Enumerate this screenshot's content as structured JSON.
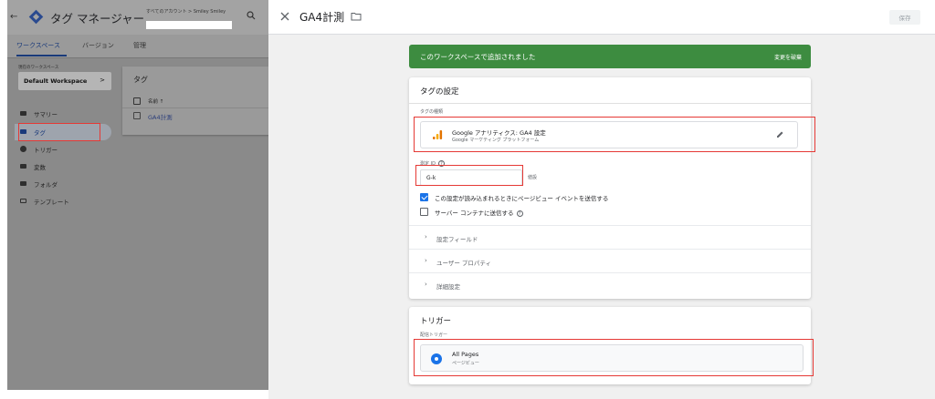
{
  "left": {
    "app_title": "タグ マネージャー",
    "account_crumb": "すべてのアカウント > Smiley Smiley",
    "nav_tabs": [
      "ワークスペース",
      "バージョン",
      "管理"
    ],
    "workspace_label": "現在のワークスペース",
    "workspace_name": "Default Workspace",
    "workspace_arrow": ">",
    "sidebar": [
      {
        "label": "サマリー",
        "icon": "briefcase-icon"
      },
      {
        "label": "タグ",
        "icon": "tag-icon"
      },
      {
        "label": "トリガー",
        "icon": "trigger-icon"
      },
      {
        "label": "変数",
        "icon": "variable-icon"
      },
      {
        "label": "フォルダ",
        "icon": "folder-icon"
      },
      {
        "label": "テンプレート",
        "icon": "template-icon"
      }
    ],
    "tags_card": {
      "title": "タグ",
      "col_name": "名前 ↑",
      "col_type": "タ",
      "rows": [
        {
          "name": "GA4計測",
          "type": "G\n設"
        }
      ]
    }
  },
  "right": {
    "close_icon": "close-icon",
    "title": "GA4計測",
    "folder_icon": "folder-outline-icon",
    "save_label": "保存",
    "banner": {
      "text": "このワークスペースで追加されました",
      "discard": "変更を破棄",
      "color": "#3d8c40"
    },
    "config": {
      "title": "タグの設定",
      "type_label": "タグの種類",
      "type_name": "Google アナリティクス: GA4 設定",
      "type_sub": "Google マーケティング プラットフォーム",
      "measurement_label": "測定 ID",
      "measurement_value": "G-k",
      "lookup_label": "値設",
      "checks": [
        {
          "label": "この設定が読み込まれるときにページビュー イベントを送信する",
          "checked": true
        },
        {
          "label": "サーバー コンテナに送信する",
          "checked": false
        }
      ],
      "collapsibles": [
        "設定フィールド",
        "ユーザー プロパティ",
        "詳細設定"
      ]
    },
    "triggers": {
      "title": "トリガー",
      "label": "配信トリガー",
      "items": [
        {
          "name": "All Pages",
          "sub": "ページビュー"
        }
      ]
    },
    "highlight_color": "#e53935"
  }
}
